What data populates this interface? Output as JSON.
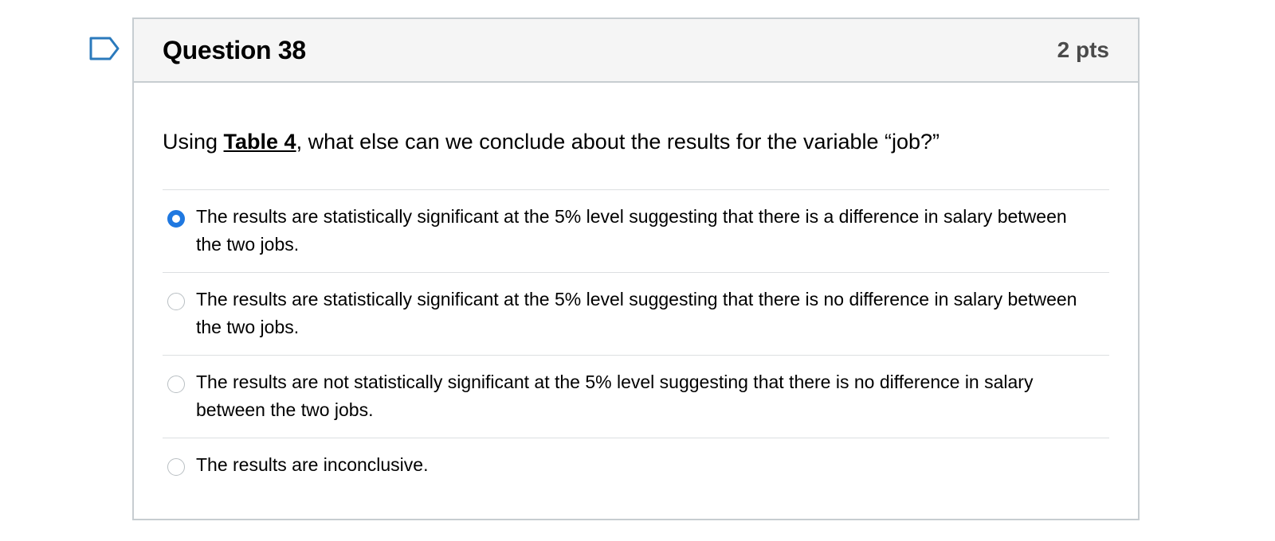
{
  "question": {
    "title": "Question 38",
    "points": "2 pts",
    "text_before": "Using ",
    "table_ref": "Table 4",
    "text_after": ", what else can we conclude about the results for the variable “job?”"
  },
  "answers": [
    {
      "label": "The results are statistically significant at the 5% level suggesting that there is a difference in salary between the two jobs.",
      "selected": true
    },
    {
      "label": "The results are statistically significant at the 5% level suggesting that there is no difference in salary between the two jobs.",
      "selected": false
    },
    {
      "label": "The results are not statistically significant at the 5% level suggesting that there is no difference in salary between the two jobs.",
      "selected": false
    },
    {
      "label": "The results are inconclusive.",
      "selected": false
    }
  ],
  "colors": {
    "accent": "#1f78e0",
    "border": "#c7cdd1",
    "header_bg": "#f5f5f5"
  },
  "icons": {
    "flag": "bookmark-flag-icon"
  }
}
